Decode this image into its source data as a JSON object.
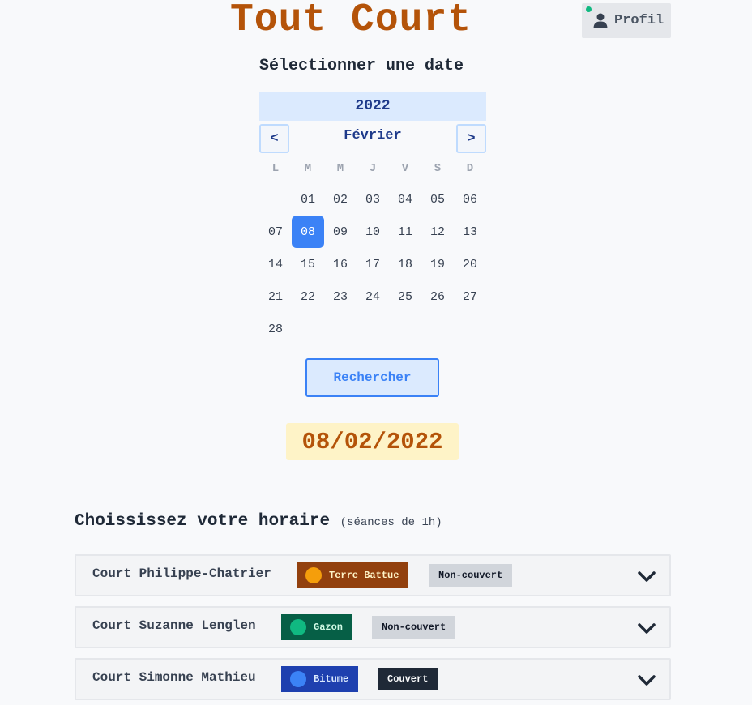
{
  "app": {
    "title": "Tout Court"
  },
  "header": {
    "profile_label": "Profil"
  },
  "calendar": {
    "heading": "Sélectionner une date",
    "year": "2022",
    "month": "Février",
    "prev_label": "<",
    "next_label": ">",
    "weekdays": [
      "L",
      "M",
      "M",
      "J",
      "V",
      "S",
      "D"
    ],
    "days": [
      "",
      "01",
      "02",
      "03",
      "04",
      "05",
      "06",
      "07",
      "08",
      "09",
      "10",
      "11",
      "12",
      "13",
      "14",
      "15",
      "16",
      "17",
      "18",
      "19",
      "20",
      "21",
      "22",
      "23",
      "24",
      "25",
      "26",
      "27",
      "28"
    ],
    "selected_day": "08"
  },
  "search": {
    "label": "Rechercher"
  },
  "selected_date": "08/02/2022",
  "schedule": {
    "title": "Choississez votre horaire",
    "subtitle": "(séances de 1h)"
  },
  "courts": [
    {
      "name": "Court Philippe-Chatrier",
      "surface": "Terre Battue",
      "cover": "Non-couvert"
    },
    {
      "name": "Court Suzanne Lenglen",
      "surface": "Gazon",
      "cover": "Non-couvert"
    },
    {
      "name": "Court Simonne Mathieu",
      "surface": "Bitume",
      "cover": "Couvert"
    }
  ],
  "colors": {
    "brand": "#b45309",
    "accent": "#3b82f6",
    "status_online": "#10b981",
    "clay": "#92400e",
    "grass": "#065f46",
    "hard": "#1e40af"
  },
  "icons": {
    "profile": "user-icon",
    "expand": "chevron-down-icon"
  }
}
